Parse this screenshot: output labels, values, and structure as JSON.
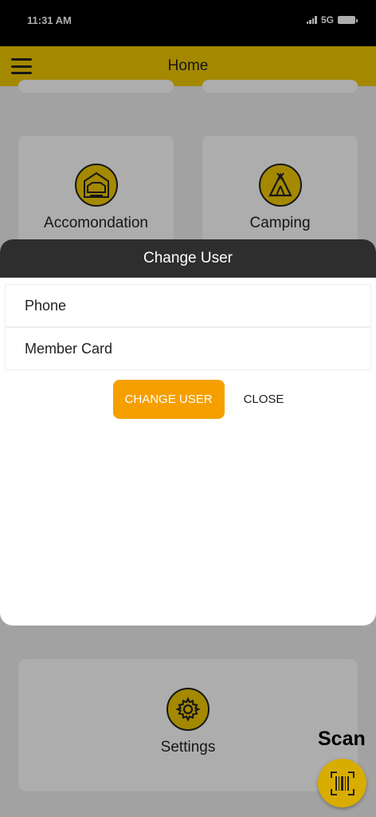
{
  "status_bar": {
    "time": "11:31 AM",
    "network": "5G"
  },
  "app_bar": {
    "title": "Home"
  },
  "tiles": {
    "accommodation": "Accomondation",
    "camping": "Camping",
    "settings": "Settings"
  },
  "dialog": {
    "title": "Change User",
    "options": [
      "Phone",
      "Member Card"
    ],
    "change_button": "CHANGE USER",
    "close_button": "CLOSE"
  },
  "scan": {
    "label": "Scan"
  },
  "colors": {
    "brand": "#f2ca00",
    "accent_button": "#f5a000",
    "dialog_header": "#2e2e2e"
  }
}
